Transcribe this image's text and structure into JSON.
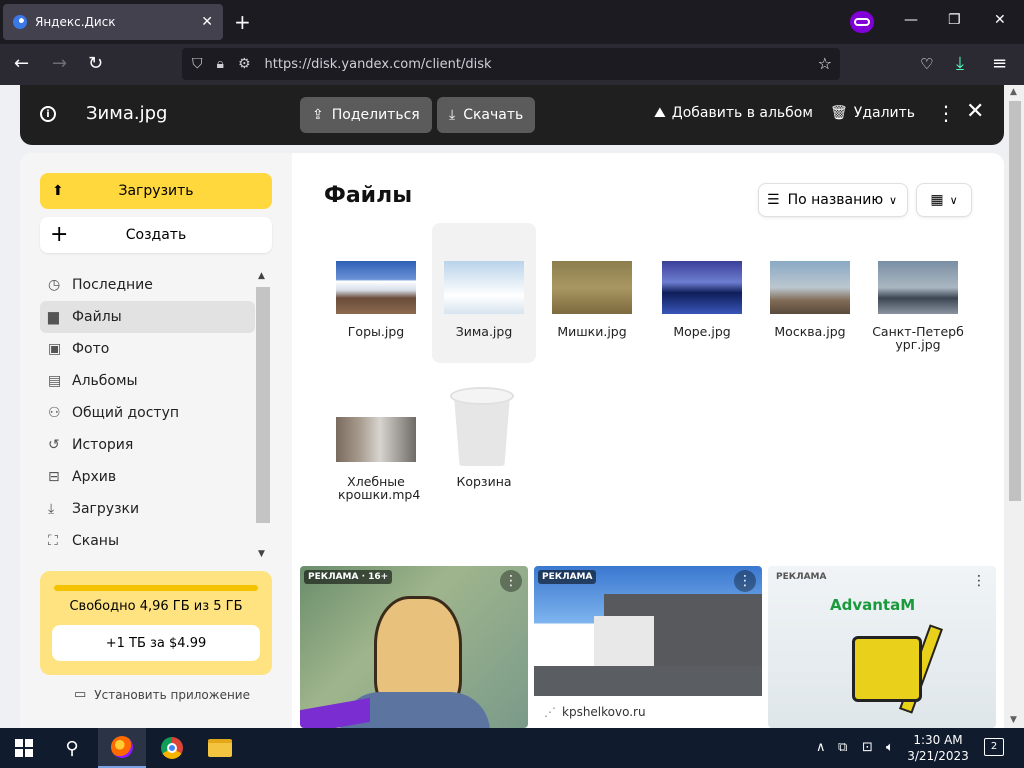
{
  "browser": {
    "tab_title": "Яндекс.Диск",
    "tab_close": "✕",
    "new_tab": "+",
    "url": "https://disk.yandex.com/client/disk",
    "window_controls": [
      "—",
      "❐",
      "✕"
    ]
  },
  "viewer": {
    "filename": "Зима.jpg",
    "share_label": "Поделиться",
    "download_label": "Скачать",
    "add_album_label": "Добавить в альбом",
    "delete_label": "Удалить"
  },
  "sidebar": {
    "upload_label": "Загрузить",
    "create_label": "Создать",
    "items": [
      {
        "label": "Последние",
        "icon": "clock-icon",
        "glyph": "◷"
      },
      {
        "label": "Файлы",
        "icon": "file-icon",
        "glyph": "▆"
      },
      {
        "label": "Фото",
        "icon": "photo-icon",
        "glyph": "▣"
      },
      {
        "label": "Альбомы",
        "icon": "album-icon",
        "glyph": "▤"
      },
      {
        "label": "Общий доступ",
        "icon": "shared-icon",
        "glyph": "⚇"
      },
      {
        "label": "История",
        "icon": "history-icon",
        "glyph": "↺"
      },
      {
        "label": "Архив",
        "icon": "archive-icon",
        "glyph": "⊟"
      },
      {
        "label": "Загрузки",
        "icon": "downloads-icon",
        "glyph": "⤓"
      },
      {
        "label": "Сканы",
        "icon": "scan-icon",
        "glyph": "⛶"
      }
    ],
    "storage_free": "Свободно 4,96 ГБ из 5 ГБ",
    "storage_plan": "+1 ТБ за $4.99",
    "install_app": "Установить приложение"
  },
  "content": {
    "title": "Файлы",
    "sort_label": "По названию",
    "files": [
      {
        "name": "Горы.jpg",
        "thumb": "t-gory"
      },
      {
        "name": "Зима.jpg",
        "thumb": "t-zima",
        "selected": true
      },
      {
        "name": "Мишки.jpg",
        "thumb": "t-mishki"
      },
      {
        "name": "Море.jpg",
        "thumb": "t-more"
      },
      {
        "name": "Москва.jpg",
        "thumb": "t-moskva"
      },
      {
        "name": "Санкт-Петербург.jpg",
        "thumb": "t-spb"
      },
      {
        "name": "Хлебные крошки.mp4",
        "thumb": "t-hleb"
      },
      {
        "name": "Корзина",
        "thumb": "trash"
      }
    ]
  },
  "ads": {
    "ad1_tag": "РЕКЛАМА · 16+",
    "ad2_tag": "РЕКЛАМА",
    "ad2_domain": "kpshelkovo.ru",
    "ad3_tag": "РЕКЛАМА",
    "ad3_brand": "AdvantaM"
  },
  "taskbar": {
    "time": "1:30 AM",
    "date": "3/21/2023",
    "notifications": "2"
  }
}
